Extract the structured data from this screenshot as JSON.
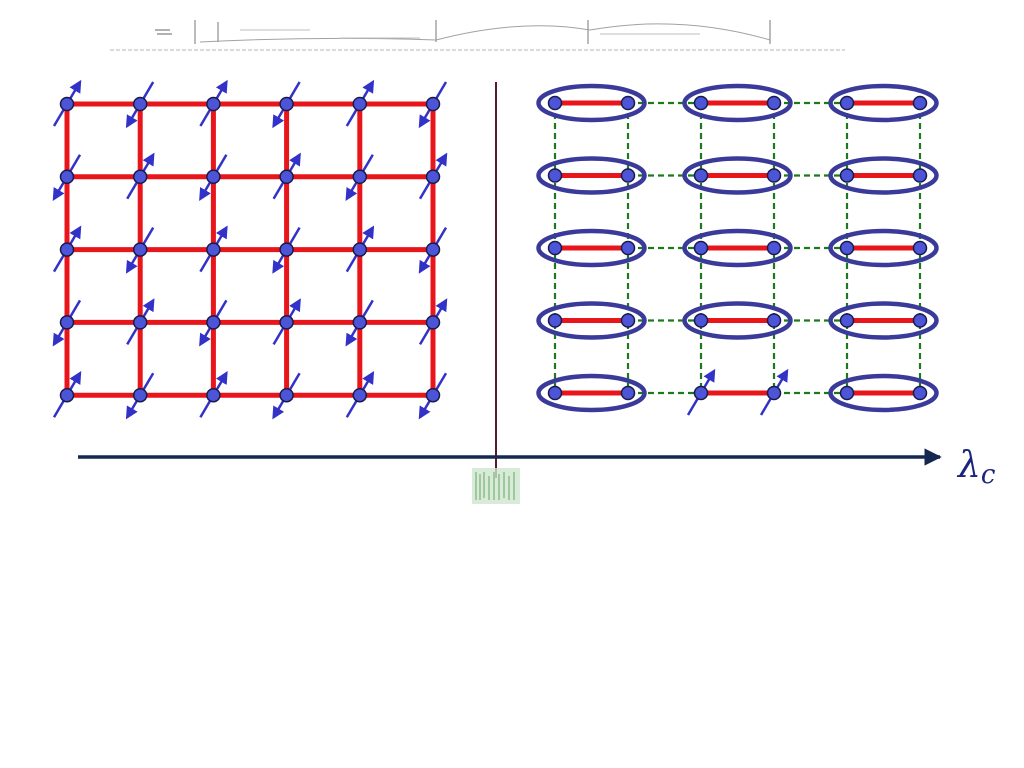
{
  "colors": {
    "bond": "#e8151b",
    "site_fill": "#4c55d8",
    "site_stroke": "#1a1a4a",
    "spin_arrow": "#3232c8",
    "dimer_ring": "#3a3a9a",
    "weak_bond": "#1c7a1c",
    "axis": "#142850",
    "transition_line": "#5a1a2a",
    "transition_label": "#6aa86a",
    "header_scribble": "#444444"
  },
  "left_panel": {
    "kind": "antiferromagnet-neel",
    "columns": 6,
    "rows": 5,
    "spin_pattern": "checkerboard-up-down"
  },
  "right_panel": {
    "kind": "dimer-singlet",
    "dimer_columns": 3,
    "rows": 5,
    "triplet_excitation": {
      "row": 5,
      "dimer_column": 2
    }
  },
  "axis": {
    "label": "λ",
    "label_subscript": "c"
  }
}
